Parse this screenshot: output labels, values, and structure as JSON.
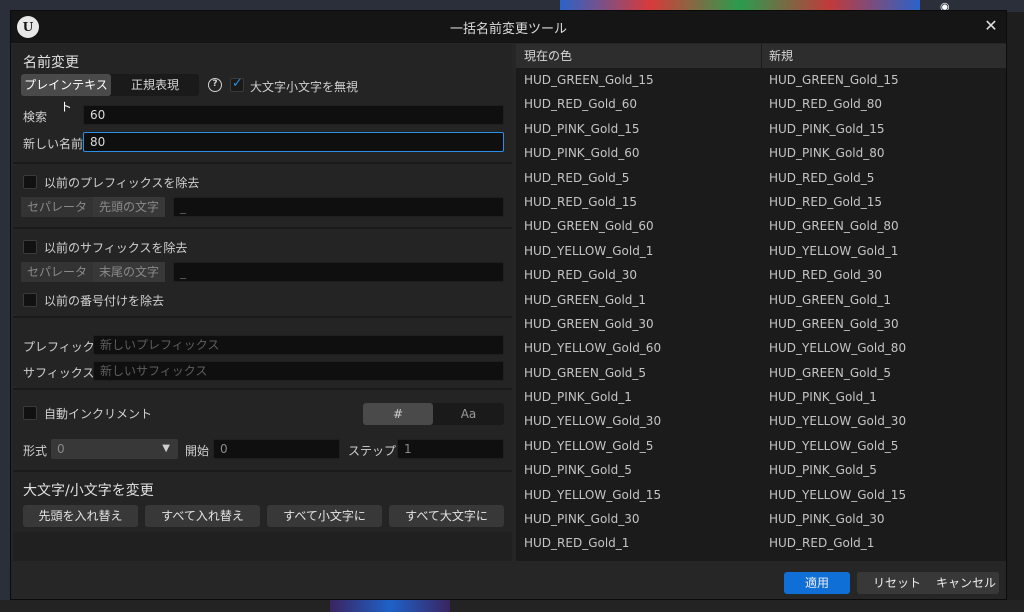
{
  "dialog": {
    "title": "一括名前変更ツール",
    "close_icon": "close-icon",
    "logo_text": "U"
  },
  "rename": {
    "heading": "名前変更",
    "mode_options": [
      "プレインテキスト",
      "正規表現"
    ],
    "mode_selected": "プレインテキスト",
    "ignore_case_label": "大文字小文字を無視",
    "ignore_case_checked": true,
    "search_label": "検索",
    "search_value": "60",
    "new_name_label": "新しい名前",
    "new_name_value": "80"
  },
  "prefix_remove": {
    "label": "以前のプレフィックスを除去",
    "checked": false,
    "separator_label": "セパレータ",
    "first_char_label": "先頭の文字",
    "value": "_"
  },
  "suffix_remove": {
    "label": "以前のサフィックスを除去",
    "checked": false,
    "separator_label": "セパレータ",
    "last_char_label": "末尾の文字",
    "value": "_",
    "numbering_label": "以前の番号付けを除去",
    "numbering_checked": false
  },
  "affix": {
    "prefix_label": "プレフィック.",
    "prefix_placeholder": "新しいプレフィックス",
    "suffix_label": "サフィックス",
    "suffix_placeholder": "新しいサフィックス"
  },
  "increment": {
    "label": "自動インクリメント",
    "checked": false,
    "type_options": [
      "#",
      "Aa"
    ],
    "format_label": "形式",
    "format_value": "0",
    "start_label": "開始",
    "start_value": "0",
    "step_label": "ステップ",
    "step_value": "1"
  },
  "case_change": {
    "heading": "大文字/小文字を変更",
    "buttons": [
      "先頭を入れ替え",
      "すべて入れ替え",
      "すべて小文字に",
      "すべて大文字に"
    ]
  },
  "table": {
    "headers": [
      "現在の色",
      "新規"
    ],
    "rows": [
      [
        "HUD_GREEN_Gold_15",
        "HUD_GREEN_Gold_15"
      ],
      [
        "HUD_RED_Gold_60",
        "HUD_RED_Gold_80"
      ],
      [
        "HUD_PINK_Gold_15",
        "HUD_PINK_Gold_15"
      ],
      [
        "HUD_PINK_Gold_60",
        "HUD_PINK_Gold_80"
      ],
      [
        "HUD_RED_Gold_5",
        "HUD_RED_Gold_5"
      ],
      [
        "HUD_RED_Gold_15",
        "HUD_RED_Gold_15"
      ],
      [
        "HUD_GREEN_Gold_60",
        "HUD_GREEN_Gold_80"
      ],
      [
        "HUD_YELLOW_Gold_1",
        "HUD_YELLOW_Gold_1"
      ],
      [
        "HUD_RED_Gold_30",
        "HUD_RED_Gold_30"
      ],
      [
        "HUD_GREEN_Gold_1",
        "HUD_GREEN_Gold_1"
      ],
      [
        "HUD_GREEN_Gold_30",
        "HUD_GREEN_Gold_30"
      ],
      [
        "HUD_YELLOW_Gold_60",
        "HUD_YELLOW_Gold_80"
      ],
      [
        "HUD_GREEN_Gold_5",
        "HUD_GREEN_Gold_5"
      ],
      [
        "HUD_PINK_Gold_1",
        "HUD_PINK_Gold_1"
      ],
      [
        "HUD_YELLOW_Gold_30",
        "HUD_YELLOW_Gold_30"
      ],
      [
        "HUD_YELLOW_Gold_5",
        "HUD_YELLOW_Gold_5"
      ],
      [
        "HUD_PINK_Gold_5",
        "HUD_PINK_Gold_5"
      ],
      [
        "HUD_YELLOW_Gold_15",
        "HUD_YELLOW_Gold_15"
      ],
      [
        "HUD_PINK_Gold_30",
        "HUD_PINK_Gold_30"
      ],
      [
        "HUD_RED_Gold_1",
        "HUD_RED_Gold_1"
      ]
    ]
  },
  "footer": {
    "apply_label": "適用",
    "reset_label": "リセット",
    "cancel_label": "キャンセル"
  },
  "colors": {
    "accent": "#2b8fe3",
    "apply_button": "#0f6fd6",
    "dialog_bg": "#262626",
    "title_bar": "#151515"
  }
}
